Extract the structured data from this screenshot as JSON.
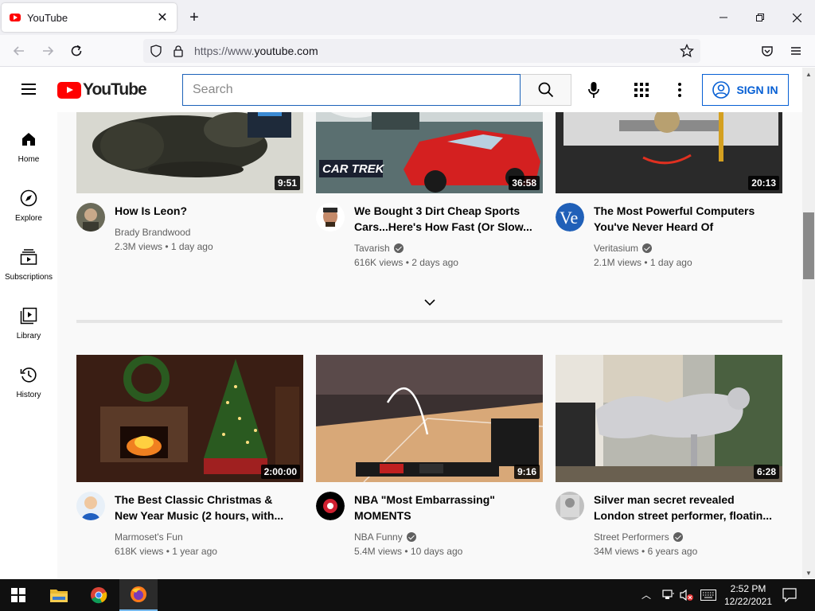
{
  "browser": {
    "tab_title": "YouTube",
    "url_prefix": "https://www.",
    "url_domain": "youtube.com"
  },
  "header": {
    "logo_text": "YouTube",
    "search_placeholder": "Search",
    "signin_label": "SIGN IN"
  },
  "sidebar": {
    "items": [
      {
        "label": "Home",
        "icon": "home-icon"
      },
      {
        "label": "Explore",
        "icon": "compass-icon"
      },
      {
        "label": "Subscriptions",
        "icon": "subscriptions-icon"
      },
      {
        "label": "Library",
        "icon": "library-icon"
      },
      {
        "label": "History",
        "icon": "history-icon"
      }
    ]
  },
  "videos": [
    {
      "title": "How Is Leon?",
      "channel": "Brady Brandwood",
      "verified": false,
      "views": "2.3M views",
      "age": "1 day ago",
      "duration": "9:51"
    },
    {
      "title": "We Bought 3 Dirt Cheap Sports Cars...Here's How Fast (Or Slow...",
      "channel": "Tavarish",
      "verified": true,
      "views": "616K views",
      "age": "2 days ago",
      "duration": "36:58"
    },
    {
      "title": "The Most Powerful Computers You've Never Heard Of",
      "channel": "Veritasium",
      "verified": true,
      "views": "2.1M views",
      "age": "1 day ago",
      "duration": "20:13"
    },
    {
      "title": "The Best Classic Christmas & New Year Music (2 hours, with...",
      "channel": "Marmoset's Fun",
      "verified": false,
      "views": "618K views",
      "age": "1 year ago",
      "duration": "2:00:00"
    },
    {
      "title": "NBA \"Most Embarrassing\" MOMENTS",
      "channel": "NBA Funny",
      "verified": true,
      "views": "5.4M views",
      "age": "10 days ago",
      "duration": "9:16"
    },
    {
      "title": "Silver man secret revealed London street performer, floatin...",
      "channel": "Street Performers",
      "verified": true,
      "views": "34M views",
      "age": "6 years ago",
      "duration": "6:28"
    }
  ],
  "taskbar": {
    "time": "2:52 PM",
    "date": "12/22/2021"
  }
}
